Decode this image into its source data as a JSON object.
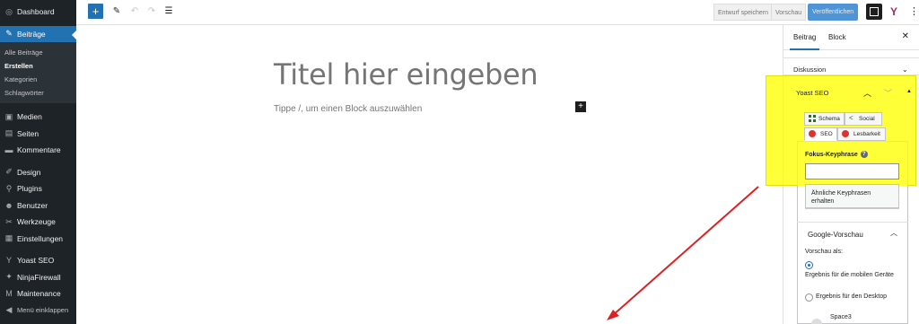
{
  "sidebar": {
    "items": [
      {
        "icon": "dashboard-icon",
        "label": "Dashboard"
      },
      {
        "icon": "pin-icon",
        "label": "Beiträge",
        "active": true
      },
      {
        "icon": "media-icon",
        "label": "Medien"
      },
      {
        "icon": "pages-icon",
        "label": "Seiten"
      },
      {
        "icon": "comments-icon",
        "label": "Kommentare"
      },
      {
        "icon": "design-icon",
        "label": "Design"
      },
      {
        "icon": "plugins-icon",
        "label": "Plugins"
      },
      {
        "icon": "users-icon",
        "label": "Benutzer"
      },
      {
        "icon": "tools-icon",
        "label": "Werkzeuge"
      },
      {
        "icon": "settings-icon",
        "label": "Einstellungen"
      },
      {
        "icon": "yoast-icon",
        "label": "Yoast SEO"
      },
      {
        "icon": "ninjafirewall-icon",
        "label": "NinjaFirewall"
      },
      {
        "icon": "maintenance-icon",
        "label": "Maintenance"
      },
      {
        "icon": "collapse-icon",
        "label": "Menü einklappen"
      }
    ],
    "submenu": [
      "Alle Beiträge",
      "Erstellen",
      "Kategorien",
      "Schlagwörter"
    ]
  },
  "toolbar": {
    "add_label": "+",
    "draft_label": "Entwurf speichern",
    "preview_label": "Vorschau",
    "publish_label": "Veröffentlichen",
    "yoast_label": "Y"
  },
  "editor": {
    "title_placeholder": "Titel hier eingeben",
    "block_placeholder": "Tippe /, um einen Block auszuwählen",
    "block_add_label": "+"
  },
  "panel": {
    "tab_post": "Beitrag",
    "tab_block": "Block",
    "close_label": "✕",
    "discussion_label": "Diskussion",
    "yoast_title": "Yoast SEO",
    "tabs": {
      "schema": "Schema",
      "social": "Social",
      "seo": "SEO",
      "readability": "Lesbarkeit"
    },
    "focus_keyphrase_label": "Fokus-Keyphrase",
    "help_label": "?",
    "similar_button": "Ähnliche Keyphrasen erhalten",
    "google_preview_title": "Google-Vorschau",
    "preview_as_label": "Vorschau als:",
    "mobile_result": "Ergebnis für die mobilen Geräte",
    "desktop_result": "Ergebnis für den Desktop",
    "site_name": "Space3"
  },
  "colors": {
    "accent": "#2271b1",
    "highlight": "#ffff00",
    "arrow": "#e02020",
    "sidebar_bg": "#1d2327"
  }
}
